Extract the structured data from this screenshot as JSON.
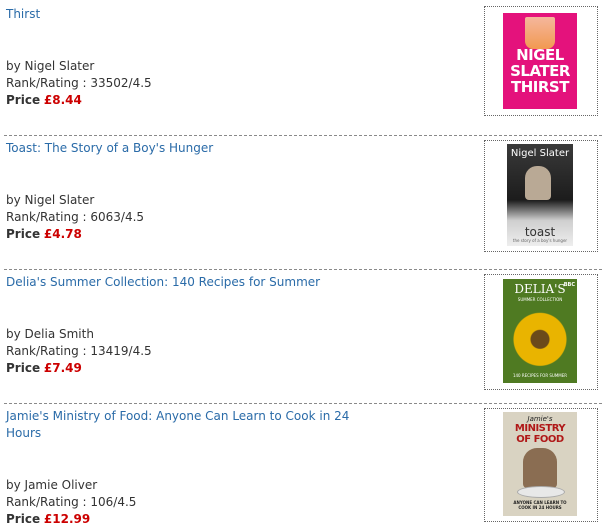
{
  "price_label": "Price",
  "colors": {
    "link": "#2a6ba8",
    "price": "#cc0000",
    "thirst_cover": "#e4127c",
    "toast_cover": "#2a2a2a",
    "delia_cover": "#3a5a1a",
    "jamie_cover": "#d9d3c2"
  },
  "items": [
    {
      "title": "Thirst",
      "author": "by Nigel Slater",
      "rank": "Rank/Rating : 33502/4.5",
      "price": "£8.44",
      "cover": {
        "line1": "NIGEL",
        "line2": "SLATER",
        "line3": "THIRST"
      }
    },
    {
      "title": "Toast: The Story of a Boy's Hunger",
      "author": "by Nigel Slater",
      "rank": "Rank/Rating : 6063/4.5",
      "price": "£4.78",
      "cover": {
        "top": "Nigel Slater",
        "main": "toast",
        "sub": "the story of a boy's hunger"
      }
    },
    {
      "title": "Delia's Summer Collection: 140 Recipes for Summer",
      "author": "by Delia Smith",
      "rank": "Rank/Rating : 13419/4.5",
      "price": "£7.49",
      "cover": {
        "top": "DELIA'S",
        "sub": "SUMMER COLLECTION",
        "bottom": "140 RECIPES FOR SUMMER",
        "badge": "BBC"
      }
    },
    {
      "title_line1": "Jamie's Ministry of Food: Anyone Can Learn to Cook in 24",
      "title_line2": "Hours",
      "author": "by Jamie Oliver",
      "rank": "Rank/Rating : 106/4.5",
      "price": "£12.99",
      "cover": {
        "top": "Jamie's",
        "main1": "MINISTRY",
        "main2": "OF FOOD",
        "bottom": "ANYONE CAN LEARN TO COOK IN 24 HOURS"
      }
    }
  ]
}
